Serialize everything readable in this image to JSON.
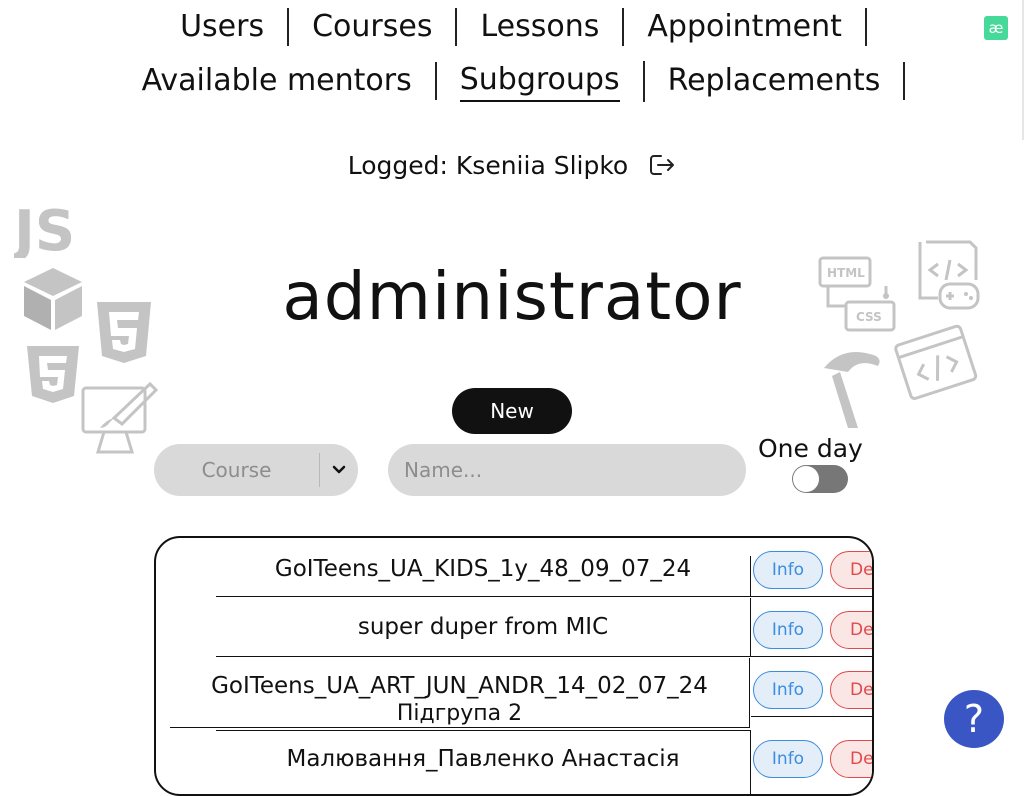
{
  "nav": {
    "row1": [
      {
        "label": "Users"
      },
      {
        "label": "Courses"
      },
      {
        "label": "Lessons"
      },
      {
        "label": "Appointment"
      }
    ],
    "row2": [
      {
        "label": "Available mentors"
      },
      {
        "label": "Subgroups",
        "active": true
      },
      {
        "label": "Replacements"
      }
    ],
    "lang_glyph": "æ"
  },
  "header": {
    "logged_text": "Logged: Kseniia Slipko",
    "title": "administrator"
  },
  "decor": {
    "js_text": "JS",
    "html_badge": "HTML",
    "css_badge": "CSS"
  },
  "controls": {
    "new_label": "New",
    "course_select_value": "Course",
    "name_placeholder": "Name...",
    "one_day_label": "One day",
    "one_day_enabled": false
  },
  "subgroups": [
    {
      "name": "GoITeens_UA_KIDS_1y_48_09_07_24",
      "sub": "",
      "info_label": "Info",
      "delete_label": "Del"
    },
    {
      "name": "super duper from MIC",
      "sub": "",
      "info_label": "Info",
      "delete_label": "Del"
    },
    {
      "name": "GoITeens_UA_ART_JUN_ANDR_14_02_07_24",
      "sub": "Підгрупа 2",
      "info_label": "Info",
      "delete_label": "Del"
    },
    {
      "name": "Малювання_Павленко Анастасія",
      "sub": "",
      "info_label": "Info",
      "delete_label": "Del"
    }
  ],
  "help": {
    "glyph": "?"
  },
  "colors": {
    "info": "#3b8de0",
    "delete": "#e14a4a",
    "help": "#3a56c5",
    "lang": "#47d99a",
    "decor": "#c4c4c4"
  }
}
